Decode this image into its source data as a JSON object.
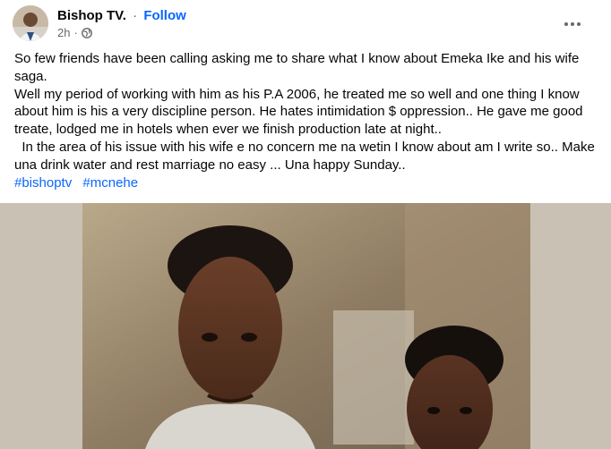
{
  "author": {
    "name": "Bishop TV.",
    "separator": "·",
    "follow_label": "Follow",
    "timestamp": "2h",
    "audience_icon": "globe-icon"
  },
  "menu": {
    "icon": "more-options-icon"
  },
  "post": {
    "paragraphs": [
      "So few friends have been calling asking me to share what I know about Emeka Ike and his wife saga.",
      "Well my period of working with him as his P.A 2006, he treated me so well and one thing I know about him is his a very discipline person. He hates intimidation $ oppression.. He gave me good treate, lodged me in hotels when ever we finish production late at night..",
      "  In the area of his issue with his wife e no concern me na wetin I know about am I write so.. Make una drink water and rest marriage no easy ... Una happy Sunday.."
    ],
    "hashtags": [
      "#bishoptv",
      "#mcnehe"
    ]
  },
  "colors": {
    "link": "#0866ff",
    "text": "#050505",
    "secondary": "#65676b"
  }
}
